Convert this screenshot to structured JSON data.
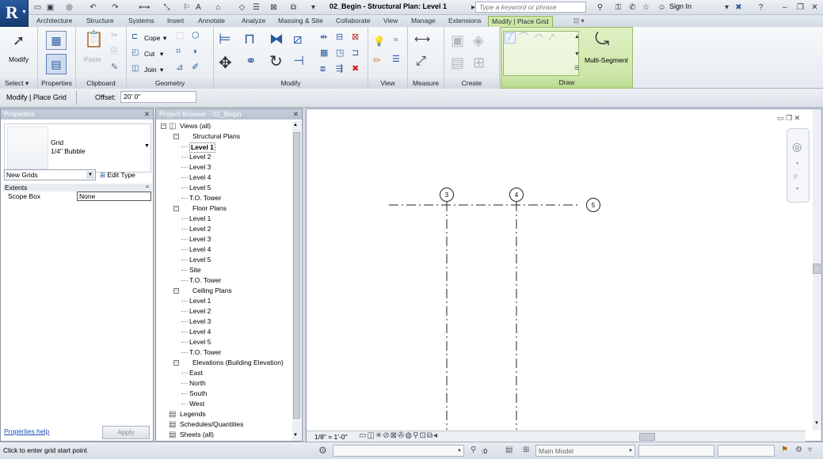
{
  "title_bar": {
    "document_title": "02_Begin - Structural Plan: Level 1",
    "search_placeholder": "Type a keyword or phrase",
    "sign_in": "Sign In"
  },
  "ribbon_tabs": [
    "Architecture",
    "Structure",
    "Systems",
    "Insert",
    "Annotate",
    "Analyze",
    "Massing & Site",
    "Collaborate",
    "View",
    "Manage",
    "Extensions",
    "Modify | Place Grid"
  ],
  "ribbon": {
    "select": {
      "modify": "Modify",
      "panel": "Select"
    },
    "properties": {
      "panel": "Properties"
    },
    "clipboard": {
      "paste": "Paste",
      "panel": "Clipboard"
    },
    "geometry": {
      "cope": "Cope",
      "cut": "Cut",
      "join": "Join",
      "panel": "Geometry"
    },
    "modify": {
      "panel": "Modify"
    },
    "view": {
      "panel": "View"
    },
    "measure": {
      "panel": "Measure"
    },
    "create": {
      "panel": "Create"
    },
    "draw": {
      "multi_segment": "Multi-Segment",
      "panel": "Draw"
    }
  },
  "options_bar": {
    "context": "Modify | Place Grid",
    "offset_label": "Offset:",
    "offset_value": "20'  0\""
  },
  "properties_palette": {
    "title": "Properties",
    "type_name": "Grid",
    "type_sub": "1/4\" Bubble",
    "selector": "New Grids",
    "edit_type": "Edit Type",
    "section": "Extents",
    "param_name": "Scope Box",
    "param_value": "None",
    "help": "Properties help",
    "apply": "Apply"
  },
  "project_browser": {
    "title": "Project Browser - 02_Begin",
    "root": "Views (all)",
    "groups": [
      {
        "name": "Structural Plans",
        "items": [
          "Level 1",
          "Level 2",
          "Level 3",
          "Level 4",
          "Level 5",
          "T.O. Tower"
        ]
      },
      {
        "name": "Floor Plans",
        "items": [
          "Level 1",
          "Level 2",
          "Level 3",
          "Level 4",
          "Level 5",
          "Site",
          "T.O. Tower"
        ]
      },
      {
        "name": "Ceiling Plans",
        "items": [
          "Level 1",
          "Level 2",
          "Level 3",
          "Level 4",
          "Level 5",
          "T.O. Tower"
        ]
      },
      {
        "name": "Elevations (Building Elevation)",
        "items": [
          "East",
          "North",
          "South",
          "West"
        ]
      }
    ],
    "extras": [
      "Legends",
      "Schedules/Quantities",
      "Sheets (all)"
    ]
  },
  "canvas": {
    "grid_bubbles": [
      "3",
      "4",
      "5"
    ],
    "scale": "1/8\" = 1'-0\""
  },
  "status_bar": {
    "message": "Click to enter grid start point",
    "workset_count": ":0",
    "model": "Main Model"
  }
}
